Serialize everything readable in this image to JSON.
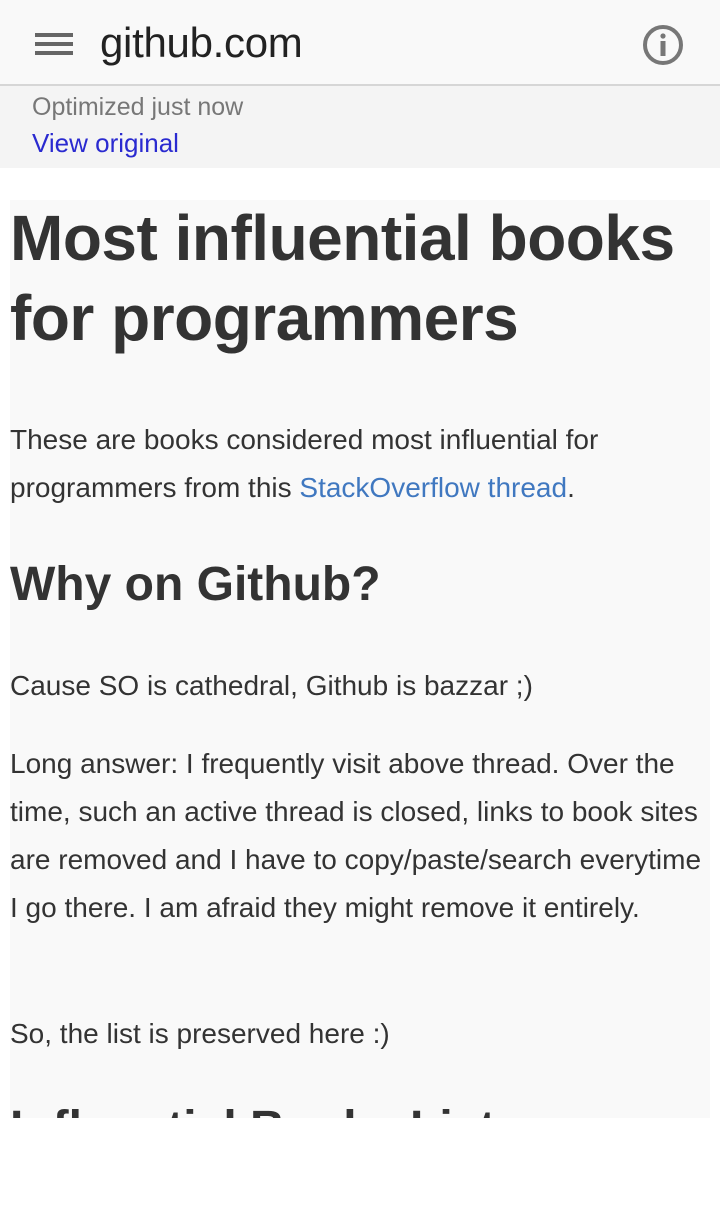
{
  "header": {
    "site_title": "github.com",
    "menu_icon": "hamburger-menu-icon",
    "info_icon": "info-circle-icon"
  },
  "notice": {
    "status": "Optimized just now",
    "view_original": "View original"
  },
  "article": {
    "title": "Most influential books for programmers",
    "intro_before_link": "These are books considered most influential for programmers from this ",
    "intro_link": "StackOverflow thread",
    "intro_after_link": ".",
    "section_why": "Why on Github?",
    "para_short": "Cause SO is cathedral, Github is bazzar ;)",
    "para_long": "Long answer: I frequently visit above thread. Over the time, such an active thread is closed, links to book sites are removed and I have to copy/paste/search everytime I go there. I am afraid they might remove it entirely.",
    "para_preserved": "So, the list is preserved here :)",
    "section_list": "Influential Books List"
  },
  "colors": {
    "link": "#4078c0",
    "view_original_link": "#2a2ad0",
    "text": "#333333",
    "content_background": "#f9f9f9"
  }
}
